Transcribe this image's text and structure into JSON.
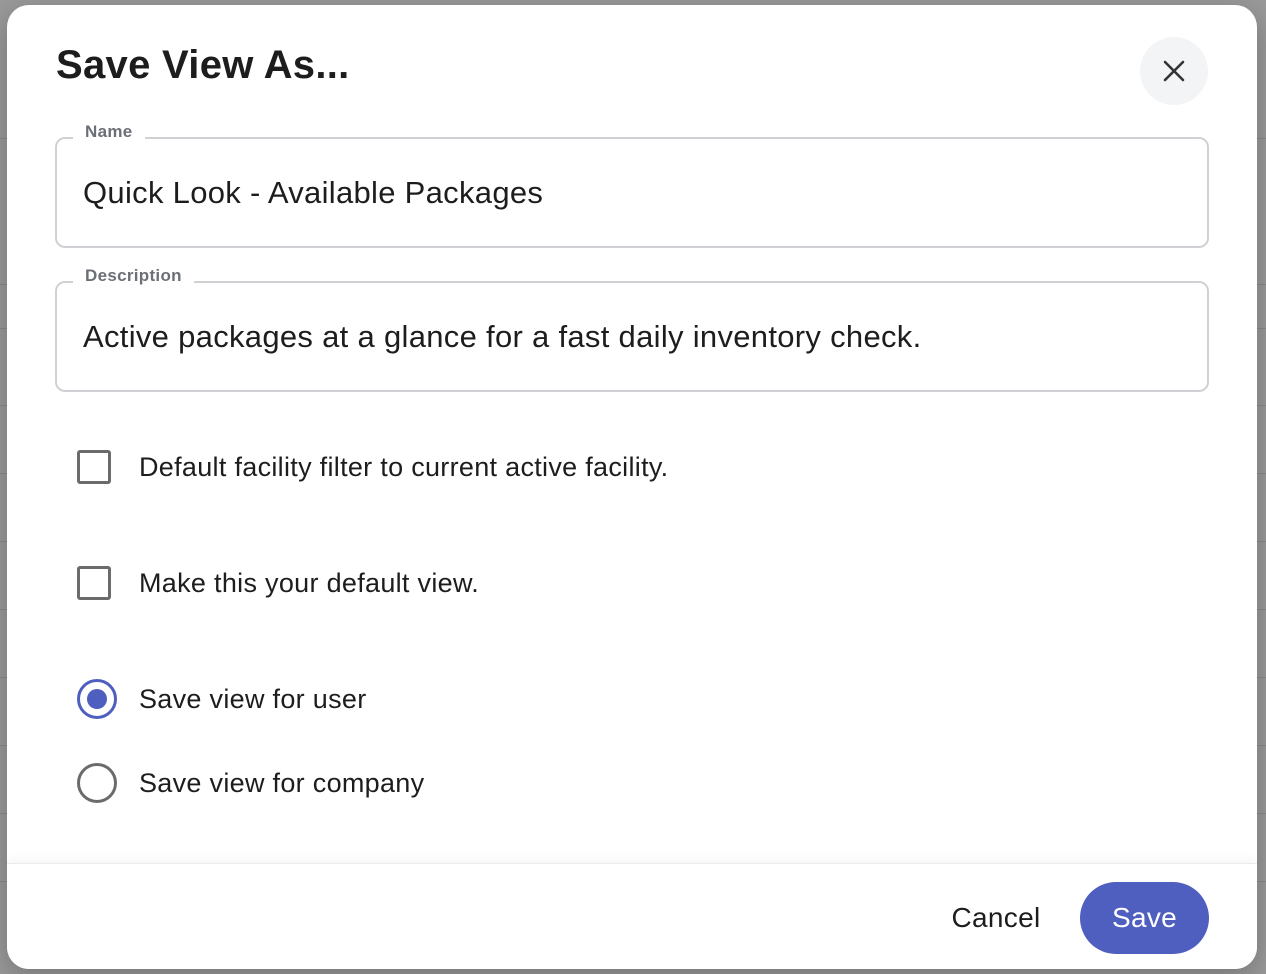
{
  "dialog": {
    "title": "Save View As...",
    "close_icon": "close-icon"
  },
  "name_field": {
    "label": "Name",
    "value": "Quick Look - Available Packages"
  },
  "description_field": {
    "label": "Description",
    "value": "Active packages at a glance for a fast daily inventory check."
  },
  "options": {
    "default_facility_filter": {
      "label": "Default facility filter to current active facility.",
      "checked": false
    },
    "default_view": {
      "label": "Make this your default view.",
      "checked": false
    }
  },
  "save_scope": {
    "user": {
      "label": "Save view for user",
      "selected": true
    },
    "company": {
      "label": "Save view for company",
      "selected": false
    }
  },
  "footer": {
    "cancel_label": "Cancel",
    "save_label": "Save"
  },
  "colors": {
    "accent": "#4f5fbf",
    "overlay": "#9a9a9a"
  }
}
